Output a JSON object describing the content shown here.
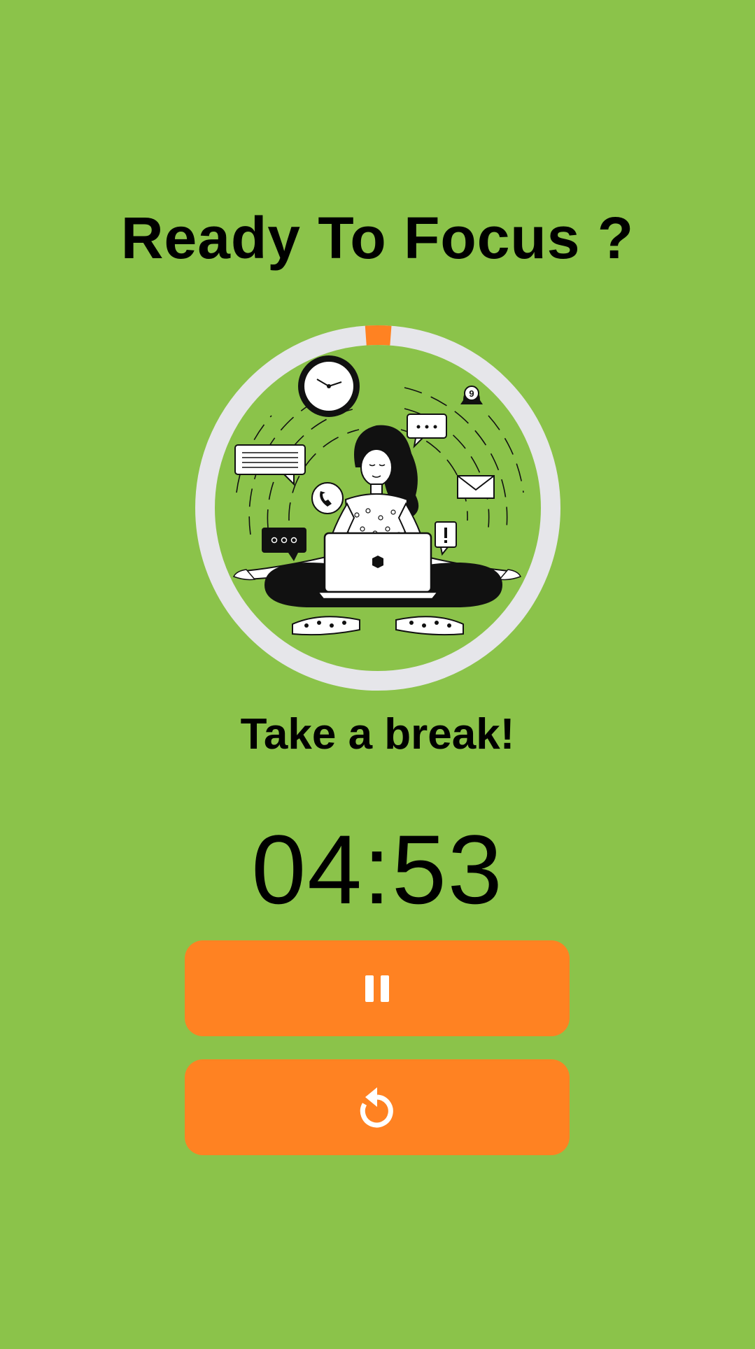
{
  "header": {
    "title": "Ready To Focus ?"
  },
  "progress": {
    "fraction_elapsed": 0.023,
    "track_color": "#E6E6EA",
    "fill_color": "#FF8222"
  },
  "illustration": {
    "description_icon": "meditating-woman-with-laptop-illustration",
    "notification_count": "9"
  },
  "status": {
    "message": "Take a break!"
  },
  "timer": {
    "display": "04:53"
  },
  "controls": {
    "pause_icon": "pause-icon",
    "reset_icon": "restart-icon",
    "button_color": "#FF8222"
  },
  "theme": {
    "background": "#8BC34A",
    "text": "#000000"
  }
}
